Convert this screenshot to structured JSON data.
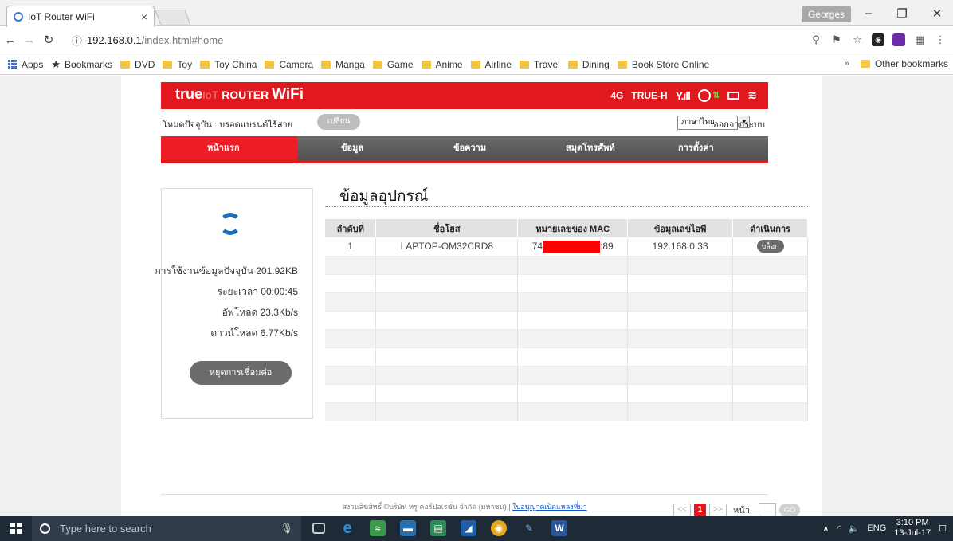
{
  "browser": {
    "tab_title": "IoT Router WiFi",
    "tab_close": "×",
    "profile_name": "Georges",
    "url_host": "192.168.0.1",
    "url_path": "/index.html#home",
    "bookmarks": [
      "Apps",
      "Bookmarks",
      "DVD",
      "Toy",
      "Toy China",
      "Camera",
      "Manga",
      "Game",
      "Anime",
      "Airline",
      "Travel",
      "Dining",
      "Book Store Online"
    ],
    "bookmarks_more": "»",
    "other_bookmarks": "Other bookmarks"
  },
  "router": {
    "logo_true": "true",
    "logo_iot": "IoT",
    "logo_router": " ROUTER ",
    "logo_wifi": "WiFi",
    "network_type": "4G",
    "carrier": "TRUE-H",
    "mode_label": "โหมดปัจจุบัน : บรอดแบรนด์ไร้สาย",
    "change_button": "เปลี่ยน",
    "language": "ภาษาไทย",
    "logout": "ออกจากระบบ",
    "menu": [
      "หน้าแรก",
      "ข้อมูล",
      "ข้อความ",
      "สมุดโทรศัพท์",
      "การตั้งค่า"
    ],
    "stats": {
      "usage": "การใช้งานข้อมูลปัจจุบัน 201.92KB",
      "duration": "ระยะเวลา 00:00:45",
      "upload": "อัพโหลด 23.3Kb/s",
      "download": "ดาวน์โหลด 6.77Kb/s"
    },
    "disconnect_button": "หยุดการเชื่อมต่อ",
    "heading": "ข้อมูลอุปกรณ์",
    "table": {
      "headers": [
        "ลำดับที่",
        "ชื่อโฮส",
        "หมายเลขของ MAC",
        "ข้อมูลเลขไอพี",
        "ดำเนินการ"
      ],
      "row": {
        "no": "1",
        "host": "LAPTOP-OM32CRD8",
        "mac_prefix": "74",
        "mac_suffix": ":89",
        "ip": "192.168.0.33",
        "action": "บล็อก"
      }
    },
    "pager": {
      "prev": "<<",
      "current": "1",
      "next": ">>",
      "page_label": "หน้า:",
      "go": "GO"
    },
    "help": "?",
    "footer_text": "สงวนลิขสิทธิ์ ©บริษัท ทรู คอร์ปอเรชั่น จำกัด (มหาชน)  |  ",
    "footer_link": "ใบอนุญาตเปิดแหล่งที่มา"
  },
  "taskbar": {
    "search_placeholder": "Type here to search",
    "language": "ENG",
    "time": "3:10 PM",
    "date": "13-Jul-17"
  },
  "colors": {
    "brand_red": "#e1191e",
    "menu_gray": "#555555",
    "redaction": "#ff0000"
  }
}
